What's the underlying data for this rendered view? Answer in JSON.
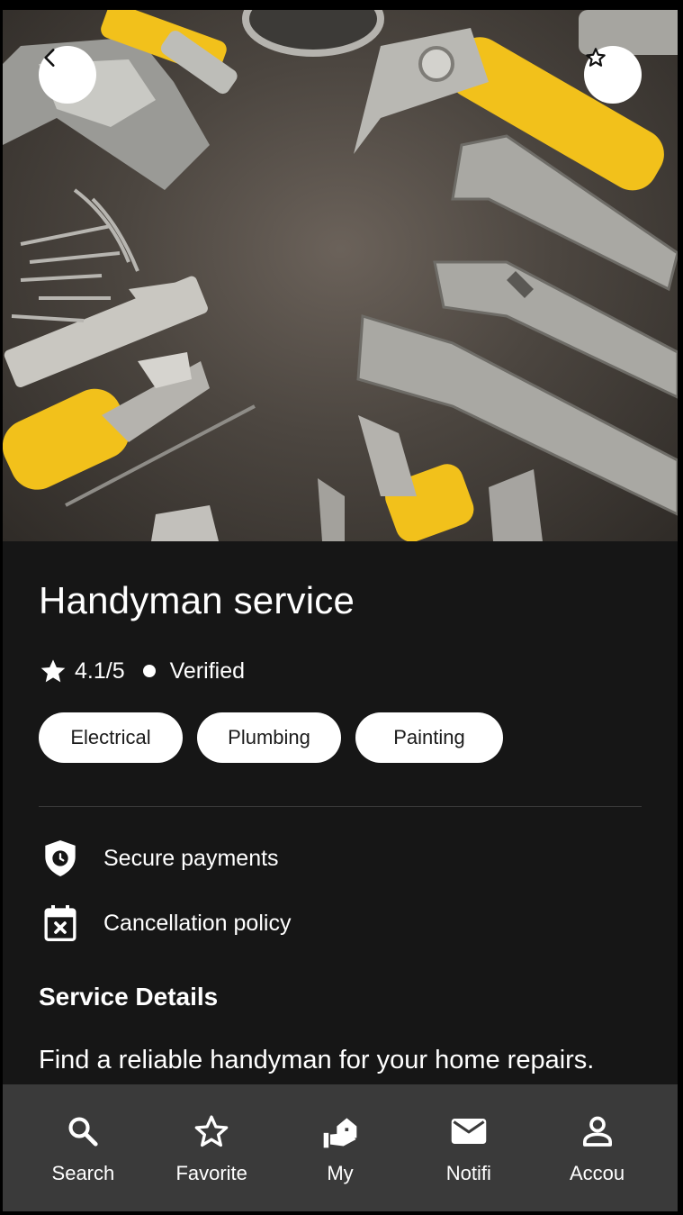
{
  "hero": {
    "image_alt": "Assorted hand tools: wrenches, pliers, hammer, screwdrivers on dark surface",
    "back_icon": "chevron-left-icon",
    "favorite_icon": "star-outline-icon"
  },
  "service": {
    "title": "Handyman service",
    "rating": "4.1/5",
    "verified_label": "Verified",
    "tags": [
      "Electrical",
      "Plumbing",
      "Painting"
    ]
  },
  "features": {
    "secure_payments": "Secure payments",
    "cancellation_policy": "Cancellation policy"
  },
  "details": {
    "heading": "Service Details",
    "description": "Find a reliable handyman for your home repairs."
  },
  "nav": {
    "items": [
      {
        "label": "Search",
        "icon": "search-icon"
      },
      {
        "label": "Favorite",
        "icon": "star-outline-icon"
      },
      {
        "label": "My",
        "icon": "my-services-icon"
      },
      {
        "label": "Notifi",
        "icon": "mail-icon"
      },
      {
        "label": "Accou",
        "icon": "person-icon"
      }
    ]
  },
  "colors": {
    "background": "#161616",
    "nav_background": "#3a3a3a",
    "chip_background": "#ffffff",
    "tool_yellow": "#f2c11b"
  }
}
